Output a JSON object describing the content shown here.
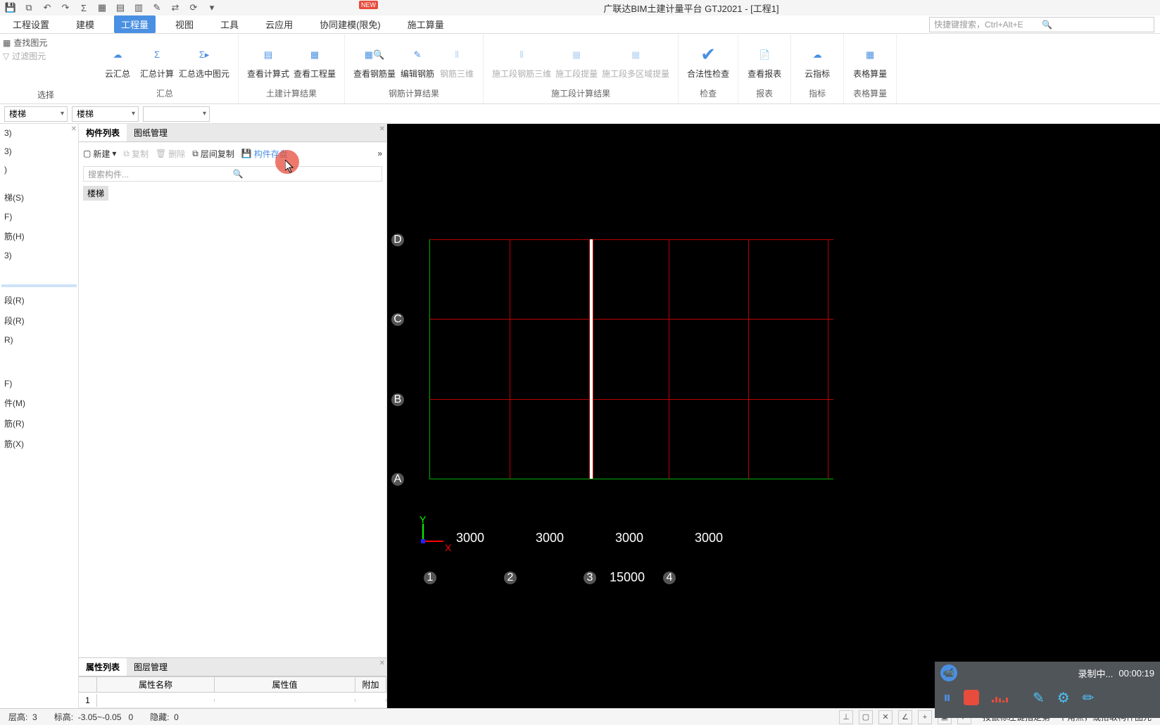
{
  "titlebar": {
    "app_title": "广联达BIM土建计量平台 GTJ2021 - [工程1]",
    "new_badge": "NEW"
  },
  "menubar": {
    "items": [
      "工程设置",
      "建模",
      "工程量",
      "视图",
      "工具",
      "云应用",
      "协同建模(限免)",
      "施工算量"
    ],
    "active_index": 2,
    "search_placeholder": "快捷键搜索，Ctrl+Alt+E"
  },
  "ribbon_left": {
    "find": "查找图元",
    "filter": "过滤图元",
    "select": "选择"
  },
  "ribbon_groups": [
    {
      "label": "汇总",
      "buttons": [
        {
          "label": "云汇总"
        },
        {
          "label": "汇总计算"
        },
        {
          "label": "汇总选中图元"
        }
      ]
    },
    {
      "label": "土建计算结果",
      "buttons": [
        {
          "label": "查看计算式"
        },
        {
          "label": "查看工程量"
        }
      ]
    },
    {
      "label": "钢筋计算结果",
      "buttons": [
        {
          "label": "查看钢筋量"
        },
        {
          "label": "编辑钢筋"
        },
        {
          "label": "钢筋三维",
          "dim": true
        }
      ]
    },
    {
      "label": "施工段计算结果",
      "buttons": [
        {
          "label": "施工段钢筋三维",
          "dim": true
        },
        {
          "label": "施工段提量",
          "dim": true
        },
        {
          "label": "施工段多区域提量",
          "dim": true
        }
      ]
    },
    {
      "label": "检查",
      "buttons": [
        {
          "label": "合法性检查"
        }
      ]
    },
    {
      "label": "报表",
      "buttons": [
        {
          "label": "查看报表"
        }
      ]
    },
    {
      "label": "指标",
      "buttons": [
        {
          "label": "云指标"
        }
      ]
    },
    {
      "label": "表格算量",
      "buttons": [
        {
          "label": "表格算量"
        }
      ]
    }
  ],
  "dropdowns": [
    "楼梯",
    "楼梯",
    ""
  ],
  "left_panel": {
    "items": [
      "3)",
      "3)",
      ")",
      "",
      "梯(S)",
      "F)",
      "筋(H)",
      "3)",
      "",
      "",
      "",
      "段(R)",
      "段(R)",
      "R)",
      "",
      "",
      "",
      "F)",
      "件(M)",
      "筋(R)",
      "筋(X)"
    ],
    "selected_index": 10
  },
  "mid_panel": {
    "tabs_top": {
      "items": [
        "构件列表",
        "图纸管理"
      ],
      "active": 0
    },
    "comp_toolbar": {
      "new": "新建",
      "copy": "复制",
      "delete": "删除",
      "layer_copy": "层间复制",
      "save": "构件存盘"
    },
    "search_placeholder": "搜索构件...",
    "comp_item": "楼梯",
    "tabs_prop": {
      "items": [
        "属性列表",
        "图层管理"
      ],
      "active": 0
    },
    "prop_header": {
      "name": "属性名称",
      "value": "属性值",
      "extra": "附加"
    },
    "prop_rows": [
      {
        "num": "1",
        "name": "",
        "value": "",
        "extra": ""
      }
    ]
  },
  "canvas": {
    "row_labels": [
      "D",
      "C",
      "B",
      "A"
    ],
    "col_labels": [
      "1",
      "2",
      "3",
      "4"
    ],
    "dims_x": [
      "3000",
      "3000",
      "3000",
      "3000"
    ],
    "dim_total": "15000",
    "coord_x": "X",
    "coord_y": "Y"
  },
  "statusbar": {
    "floor_label": "层高:",
    "floor": "3",
    "elev_label": "标高:",
    "elev": "-3.05~-0.05",
    "elev2": "0",
    "hidden_label": "隐藏:",
    "hidden": "0",
    "hint": "按鼠标左键指定第一个角点，或拾取构件图元"
  },
  "recorder": {
    "status": "录制中...",
    "time": "00:00:19"
  }
}
